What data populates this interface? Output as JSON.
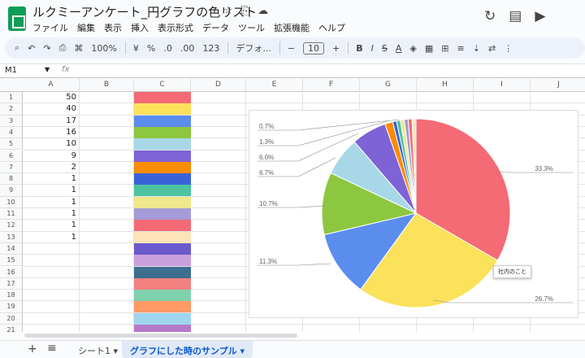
{
  "app": {
    "title": "ルクミーアンケート_円グラフの色リスト",
    "menu": [
      "ファイル",
      "編集",
      "表示",
      "挿入",
      "表示形式",
      "データ",
      "ツール",
      "拡張機能",
      "ヘルプ"
    ],
    "icons": {
      "star": "☆",
      "folder": "⎘",
      "cloud": "☁",
      "history": "↻",
      "comment": "▤",
      "video": "▶"
    }
  },
  "toolbar": {
    "zoom": "100%",
    "currency": "¥",
    "percent": "%",
    "dec_less": ".0",
    "dec_more": ".00",
    "numfmt": "123",
    "font": "デフォ...",
    "font_size": "10",
    "bold": "B",
    "italic": "I",
    "strike": "S",
    "textcolor": "A",
    "minus": "−",
    "plus": "+"
  },
  "namebox": {
    "cell": "M1",
    "fx": "fx"
  },
  "columns": [
    "A",
    "B",
    "C",
    "D",
    "E",
    "F",
    "G",
    "H",
    "I",
    "J"
  ],
  "rows": [
    "1",
    "2",
    "3",
    "4",
    "5",
    "6",
    "7",
    "8",
    "9",
    "10",
    "11",
    "12",
    "13",
    "14",
    "15",
    "16",
    "17",
    "18",
    "19",
    "20",
    "21"
  ],
  "col_a_values": [
    "50",
    "40",
    "17",
    "16",
    "10",
    "9",
    "2",
    "1",
    "1",
    "1",
    "1",
    "1",
    "1"
  ],
  "swatch_colors": [
    "#f46a75",
    "#fce15a",
    "#5b8def",
    "#8dc63f",
    "#a8d8e8",
    "#7e63d6",
    "#fb8c00",
    "#3a62d8",
    "#4dc3a0",
    "#f0e68c",
    "#a59bd6",
    "#f46a75",
    "#fde3b8",
    "#6a5acd",
    "#c9a0dc",
    "#3b6e8f",
    "#f48080",
    "#7fd1ae",
    "#ff9966",
    "#9fd5ee",
    "#b779c9"
  ],
  "chart_data": {
    "type": "pie",
    "values": [
      50,
      40,
      17,
      16,
      10,
      9,
      2,
      1,
      1,
      1,
      1,
      1,
      1
    ],
    "colors": [
      "#f46a75",
      "#fce15a",
      "#5b8def",
      "#8dc63f",
      "#a8d8e8",
      "#7e63d6",
      "#fb8c00",
      "#3a62d8",
      "#4dc3a0",
      "#f0e68c",
      "#a59bd6",
      "#f46a75",
      "#fde3b8"
    ],
    "labels": {
      "s0": "33.3%",
      "s1": "26.7%",
      "s2": "11.3%",
      "s3": "10.7%",
      "s4": "6.7%",
      "s5": "6.0%",
      "s6": "1.3%",
      "s7": "0.7%"
    },
    "tooltip": "社内のこと"
  },
  "tabs": {
    "plus": "+",
    "menu": "≡",
    "sheet1": "シート1 ▾",
    "sheet2": "グラフにした時のサンプル ▾"
  }
}
